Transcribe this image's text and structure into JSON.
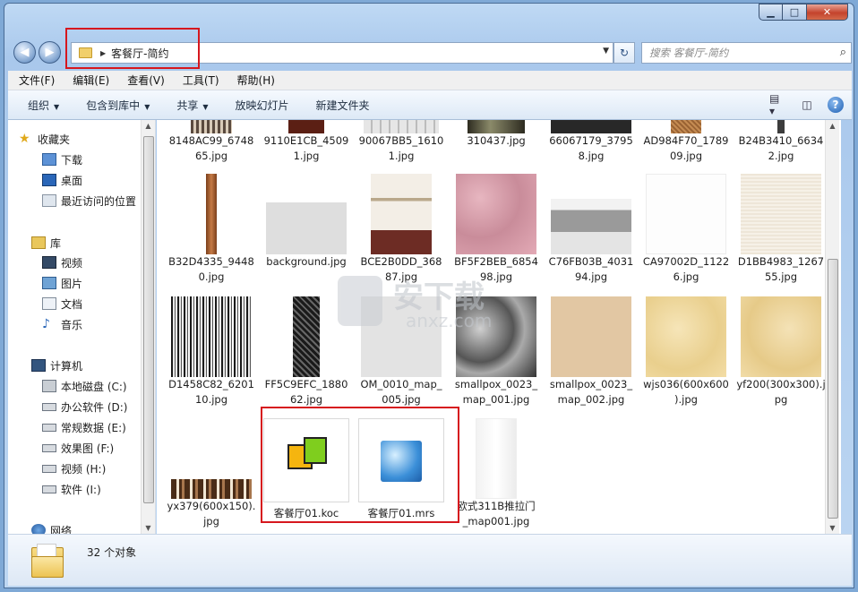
{
  "window": {
    "caption": {
      "minimize": "▁",
      "maximize": "□",
      "close": "✕"
    }
  },
  "address_bar": {
    "breadcrumb": "客餐厅-简约",
    "search_placeholder": "搜索 客餐厅-简约"
  },
  "menu": [
    "文件(F)",
    "编辑(E)",
    "查看(V)",
    "工具(T)",
    "帮助(H)"
  ],
  "toolbar": {
    "organize": "组织",
    "include_in_library": "包含到库中",
    "share": "共享",
    "slideshow": "放映幻灯片",
    "new_folder": "新建文件夹"
  },
  "sidebar": {
    "favorites": {
      "label": "收藏夹",
      "items": [
        "下载",
        "桌面",
        "最近访问的位置"
      ]
    },
    "libraries": {
      "label": "库",
      "items": [
        "视频",
        "图片",
        "文档",
        "音乐"
      ]
    },
    "computer": {
      "label": "计算机",
      "items": [
        "本地磁盘 (C:)",
        "办公软件 (D:)",
        "常规数据 (E:)",
        "效果图 (F:)",
        "视频 (H:)",
        "软件 (I:)"
      ]
    },
    "network": {
      "label": "网络"
    }
  },
  "files": [
    {
      "name": "8148AC99_674865.jpg",
      "line1": "8148AC99_6748",
      "line2": "65.jpg"
    },
    {
      "name": "9110E1CB_45091.jpg",
      "line1": "9110E1CB_4509",
      "line2": "1.jpg"
    },
    {
      "name": "90067BB5_16101.jpg",
      "line1": "90067BB5_1610",
      "line2": "1.jpg"
    },
    {
      "name": "310437.jpg",
      "line1": "310437.jpg",
      "line2": ""
    },
    {
      "name": "66067179_37958.jpg",
      "line1": "66067179_3795",
      "line2": "8.jpg"
    },
    {
      "name": "AD984F70_178909.jpg",
      "line1": "AD984F70_1789",
      "line2": "09.jpg"
    },
    {
      "name": "B24B3410_66342.jpg",
      "line1": "B24B3410_6634",
      "line2": "2.jpg"
    },
    {
      "name": "B32D4335_94480.jpg",
      "line1": "B32D4335_9448",
      "line2": "0.jpg"
    },
    {
      "name": "background.jpg",
      "line1": "background.jpg",
      "line2": ""
    },
    {
      "name": "BCE2B0DD_36887.jpg",
      "line1": "BCE2B0DD_368",
      "line2": "87.jpg"
    },
    {
      "name": "BF5F2BEB_685498.jpg",
      "line1": "BF5F2BEB_6854",
      "line2": "98.jpg"
    },
    {
      "name": "C76FB03B_403194.jpg",
      "line1": "C76FB03B_4031",
      "line2": "94.jpg"
    },
    {
      "name": "CA97002D_11226.jpg",
      "line1": "CA97002D_1122",
      "line2": "6.jpg"
    },
    {
      "name": "D1BB4983_126755.jpg",
      "line1": "D1BB4983_1267",
      "line2": "55.jpg"
    },
    {
      "name": "D1458C82_620110.jpg",
      "line1": "D1458C82_6201",
      "line2": "10.jpg"
    },
    {
      "name": "FF5C9EFC_188062.jpg",
      "line1": "FF5C9EFC_1880",
      "line2": "62.jpg"
    },
    {
      "name": "OM_0010_map_005.jpg",
      "line1": "OM_0010_map_",
      "line2": "005.jpg"
    },
    {
      "name": "smallpox_0023_map_001.jpg",
      "line1": "smallpox_0023_",
      "line2": "map_001.jpg"
    },
    {
      "name": "smallpox_0023_map_002.jpg",
      "line1": "smallpox_0023_",
      "line2": "map_002.jpg"
    },
    {
      "name": "wjs036(600x600).jpg",
      "line1": "wjs036(600x600",
      "line2": ").jpg"
    },
    {
      "name": "yf200(300x300).jpg",
      "line1": "yf200(300x300).j",
      "line2": "pg"
    },
    {
      "name": "yx379(600x150).jpg",
      "line1": "yx379(600x150).",
      "line2": "jpg"
    },
    {
      "name": "客餐厅01.koc",
      "line1": "客餐厅01.koc",
      "line2": ""
    },
    {
      "name": "客餐厅01.mrs",
      "line1": "客餐厅01.mrs",
      "line2": ""
    },
    {
      "name": "欧式311B推拉门_map001.jpg",
      "line1": "欧式311B推拉门",
      "line2": "_map001.jpg"
    }
  ],
  "status": {
    "count": "32 个对象"
  },
  "watermark": {
    "text": "安下载",
    "sub": "anxz.com"
  }
}
